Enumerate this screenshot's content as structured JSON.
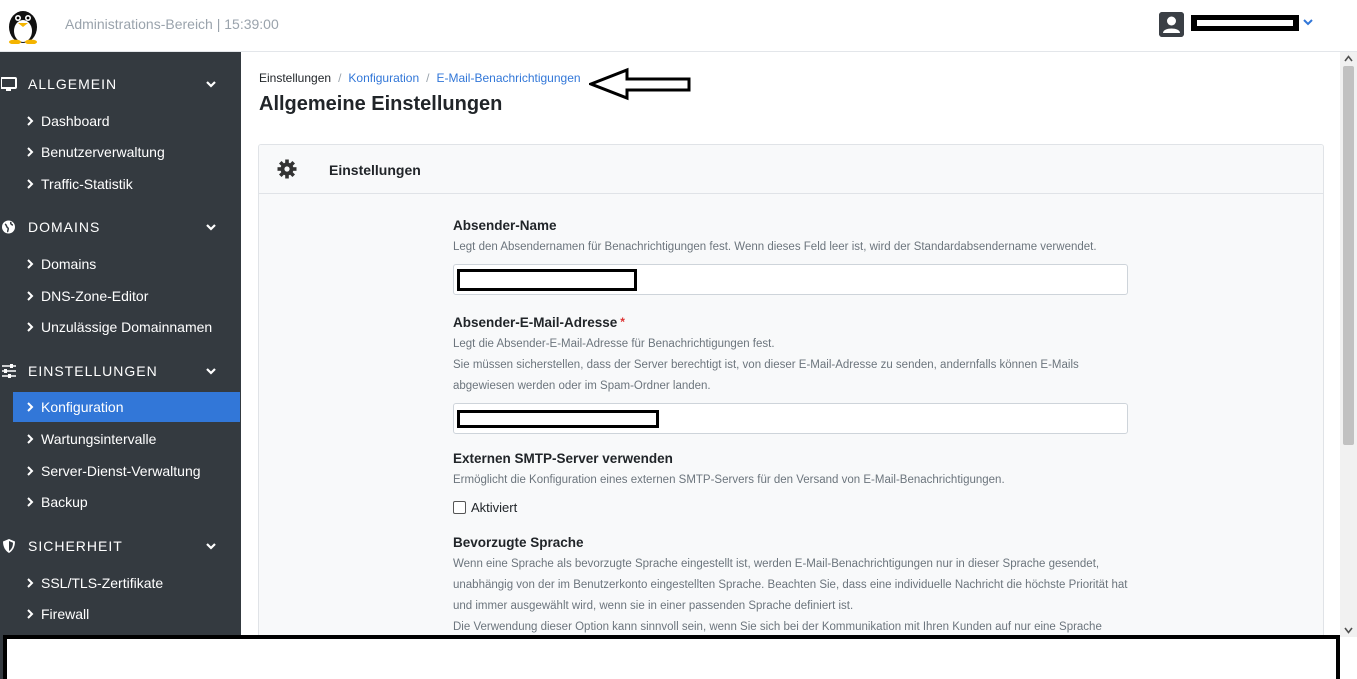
{
  "header": {
    "title": "Administrations-Bereich | 15:39:00",
    "logo_icon": "penguin-logo-icon",
    "user_icon": "user-icon",
    "user_menu_icon": "chevron-down-icon"
  },
  "sidebar": {
    "sections": [
      {
        "label": "ALLGEMEIN",
        "icon": "monitor-icon",
        "items": [
          {
            "label": "Dashboard"
          },
          {
            "label": "Benutzerverwaltung"
          },
          {
            "label": "Traffic-Statistik"
          }
        ]
      },
      {
        "label": "DOMAINS",
        "icon": "globe-icon",
        "items": [
          {
            "label": "Domains"
          },
          {
            "label": "DNS-Zone-Editor"
          },
          {
            "label": "Unzulässige Domainnamen"
          }
        ]
      },
      {
        "label": "EINSTELLUNGEN",
        "icon": "sliders-icon",
        "items": [
          {
            "label": "Konfiguration",
            "active": true
          },
          {
            "label": "Wartungsintervalle"
          },
          {
            "label": "Server-Dienst-Verwaltung"
          },
          {
            "label": "Backup"
          }
        ]
      },
      {
        "label": "SICHERHEIT",
        "icon": "shield-icon",
        "items": [
          {
            "label": "SSL/TLS-Zertifikate"
          },
          {
            "label": "Firewall"
          }
        ]
      }
    ]
  },
  "breadcrumb": {
    "items": [
      "Einstellungen",
      "Konfiguration",
      "E-Mail-Benachrichtigungen"
    ],
    "separator": "/"
  },
  "page": {
    "title": "Allgemeine Einstellungen"
  },
  "card": {
    "title": "Einstellungen",
    "icon": "gear-icon"
  },
  "form": {
    "sender_name": {
      "label": "Absender-Name",
      "help": "Legt den Absendernamen für Benachrichtigungen fest. Wenn dieses Feld leer ist, wird der Standardabsendername verwendet."
    },
    "sender_email": {
      "label": "Absender-E-Mail-Adresse",
      "required_mark": "*",
      "help": "Legt die Absender-E-Mail-Adresse für Benachrichtigungen fest.\nSie müssen sicherstellen, dass der Server berechtigt ist, von dieser E-Mail-Adresse zu senden, andernfalls können E-Mails abgewiesen werden oder im Spam-Ordner landen."
    },
    "smtp": {
      "label": "Externen SMTP-Server verwenden",
      "help": "Ermöglicht die Konfiguration eines externen SMTP-Servers für den Versand von E-Mail-Benachrichtigungen.",
      "checkbox_label": "Aktiviert",
      "checked": false
    },
    "language": {
      "label": "Bevorzugte Sprache",
      "help": "Wenn eine Sprache als bevorzugte Sprache eingestellt ist, werden E-Mail-Benachrichtigungen nur in dieser Sprache gesendet, unabhängig von der im Benutzerkonto eingestellten Sprache. Beachten Sie, dass eine individuelle Nachricht die höchste Priorität hat und immer ausgewählt wird, wenn sie in einer passenden Sprache definiert ist.\nDie Verwendung dieser Option kann sinnvoll sein, wenn Sie sich bei der Kommunikation mit Ihren Kunden auf nur eine Sprache"
    }
  },
  "colors": {
    "sidebar_bg": "#343a40",
    "accent": "#3277d8",
    "required": "#dd3333"
  }
}
